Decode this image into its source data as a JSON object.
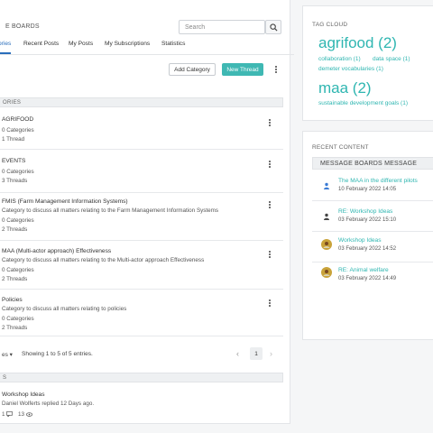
{
  "header": {
    "title": "E BOARDS",
    "search_placeholder": "Search"
  },
  "tabs": [
    {
      "label": "ories",
      "active": true
    },
    {
      "label": "Recent Posts"
    },
    {
      "label": "My Posts"
    },
    {
      "label": "My Subscriptions"
    },
    {
      "label": "Statistics"
    }
  ],
  "toolbar": {
    "add_category": "Add Category",
    "new_thread": "New Thread"
  },
  "categories_header": "ORIES",
  "categories": [
    {
      "name": "AGRIFOOD",
      "description": "",
      "categories": "0 Categories",
      "threads": "1 Thread"
    },
    {
      "name": "EVENTS",
      "description": "",
      "categories": "0 Categories",
      "threads": "3 Threads"
    },
    {
      "name": "FMIS (Farm Management Information Systems)",
      "description": "Category to discuss all matters relating to the Farm Management Information Systems",
      "categories": "0 Categories",
      "threads": "2 Threads"
    },
    {
      "name": "MAA (Multi-actor approach) Effectiveness",
      "description": "Category to discuss all matters relating to the Multi-actor approach Effectiveness",
      "categories": "0 Categories",
      "threads": "2 Threads"
    },
    {
      "name": "Policies",
      "description": "Category to discuss all matters relating to policies",
      "categories": "0 Categories",
      "threads": "2 Threads"
    }
  ],
  "pagination": {
    "entries_label": "es ▾",
    "showing": "Showing 1 to 5 of 5 entries.",
    "page": "1",
    "prev": "‹",
    "next": "›"
  },
  "threads_header": "S",
  "threads": [
    {
      "title": "Workshop Ideas",
      "meta": "Daniel Wolferts replied 12 Days ago.",
      "replies": "1",
      "views": "13"
    }
  ],
  "tag_cloud": {
    "title": "TAG CLOUD",
    "tags": {
      "agrifood": "agrifood (2)",
      "collaboration": "collaboration (1)",
      "data_space": "data space (1)",
      "demeter": "demeter vocabularies (1)",
      "maa": "maa (2)",
      "sdg": "sustainable development goals (1)"
    }
  },
  "recent_content": {
    "title": "RECENT CONTENT",
    "header": "MESSAGE BOARDS MESSAGE",
    "items": [
      {
        "title": "The MAA in the different pilots",
        "date": "10 February 2022 14:05",
        "avatar": "user-icon"
      },
      {
        "title": "RE: Workshop Ideas",
        "date": "03 February 2022 15:10",
        "avatar": "user-icon"
      },
      {
        "title": "Workshop Ideas",
        "date": "03 February 2022 14:52",
        "avatar": "photo-avatar"
      },
      {
        "title": "RE: Animal welfare",
        "date": "03 February 2022 14:49",
        "avatar": "photo-avatar"
      }
    ]
  },
  "colors": {
    "accent": "#2fb6b1",
    "tab_active": "#2a6ebb"
  }
}
